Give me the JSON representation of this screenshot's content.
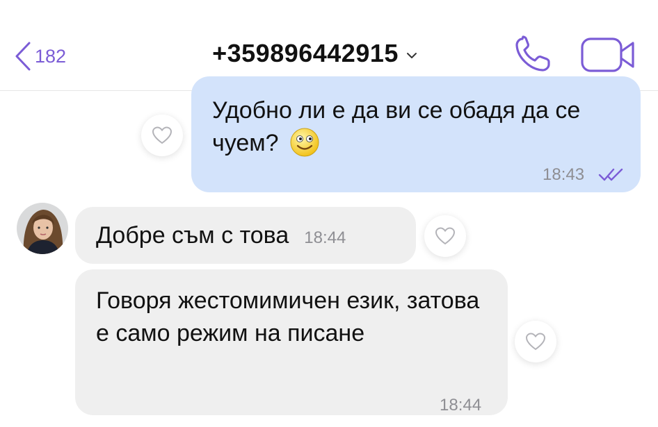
{
  "header": {
    "back_count": "182",
    "contact": "+359896442915"
  },
  "messages": [
    {
      "direction": "outgoing",
      "text": "Удобно ли е да ви се обадя да се чуем?",
      "emoji": "smiling-face-emoji",
      "time": "18:43",
      "status": "read"
    },
    {
      "direction": "incoming",
      "text": "Добре съм с това",
      "time": "18:44"
    },
    {
      "direction": "incoming",
      "text": "Говоря жестомимичен език, затова е само режим на писане",
      "time": "18:44"
    }
  ],
  "colors": {
    "accent": "#7b5cd6",
    "outgoing_bubble": "#d3e3fb",
    "incoming_bubble": "#efefef"
  }
}
